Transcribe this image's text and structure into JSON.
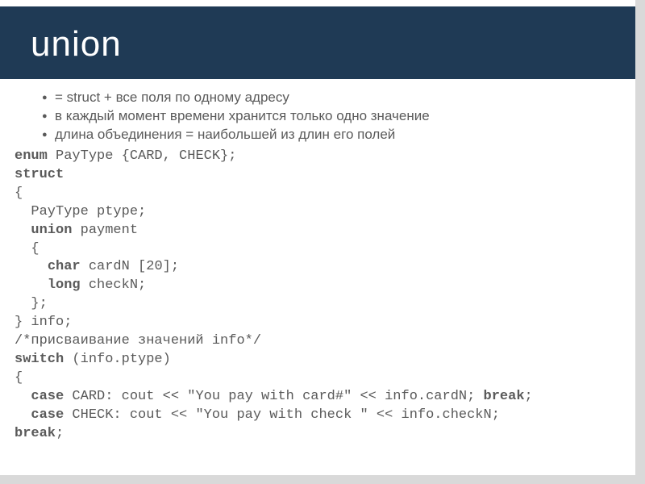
{
  "title": "union",
  "bullets": [
    " = struct + все поля по одному адресу",
    "в каждый момент времени хранится только одно значение",
    "длина объединения = наибольшей из длин его полей"
  ],
  "code": {
    "l1_kw": "enum",
    "l1_rest": " PayType {CARD, CHECK};",
    "l2_kw": "struct",
    "l3": "{",
    "l4": "  PayType ptype;",
    "l5_lead": "  ",
    "l5_kw": "union",
    "l5_rest": " payment",
    "l6": "  {",
    "l7_lead": "    ",
    "l7_kw": "char",
    "l7_rest": " cardN [20];",
    "l8_lead": "    ",
    "l8_kw": "long",
    "l8_rest": " checkN;",
    "l9": "  };",
    "l10": "} info;",
    "l11": "/*присваивание значений info*/",
    "l12_kw": "switch",
    "l12_rest": " (info.ptype)",
    "l13": "{",
    "l14_lead": "  ",
    "l14_kw1": "case",
    "l14_mid": " CARD: cout << \"You pay with card#\" << info.cardN; ",
    "l14_kw2": "break",
    "l14_end": ";",
    "l15_lead": "  ",
    "l15_kw1": "case",
    "l15_mid": " CHECK: cout << \"You pay with check \" << info.checkN;",
    "l16_kw": "break",
    "l16_end": ";"
  }
}
